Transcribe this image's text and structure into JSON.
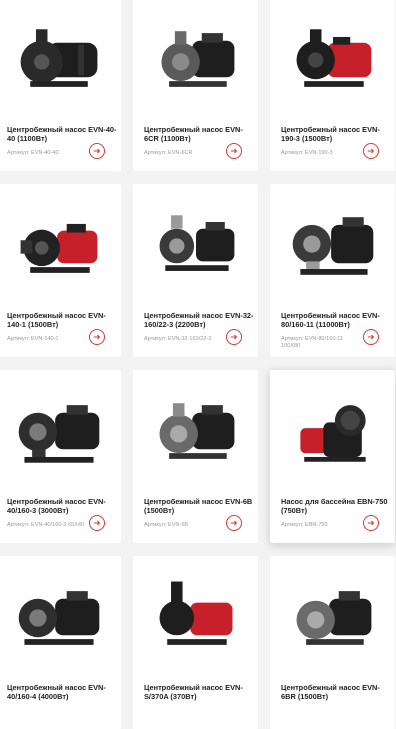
{
  "colors": {
    "accent": "#d33a3a",
    "pump_dark": "#1e1e1e",
    "pump_red": "#c8202a"
  },
  "products": [
    {
      "title": "Центробежный насос EVN-40-40 (1100Вт)",
      "sku": "Артикул: EVN-40-40",
      "icon": "pump-black-icon"
    },
    {
      "title": "Центробежный насос EVN-6CR (1100Вт)",
      "sku": "Артикул: EVN-6CR",
      "icon": "pump-black-icon"
    },
    {
      "title": "Центробежный насос EVN-190-3 (1500Вт)",
      "sku": "Артикул: EVN-190-3",
      "icon": "pump-red-icon"
    },
    {
      "title": "Центробежный насос EVN-140-1 (1500Вт)",
      "sku": "Артикул: EVN-140-1",
      "icon": "pump-red-icon"
    },
    {
      "title": "Центробежный насос EVN-32-160/22-3 (2200Вт)",
      "sku": "Артикул: EVN-32-160/22-3",
      "icon": "pump-black-icon"
    },
    {
      "title": "Центробежный насос EVN-80/160-11 (11000Вт)",
      "sku": "Артикул: EVN-80/160-11 100X80",
      "icon": "pump-black-icon"
    },
    {
      "title": "Центробежный насос EVN-40/160-3 (3000Вт)",
      "sku": "Артикул: EVN-40/160-3 65X40",
      "icon": "pump-black-icon"
    },
    {
      "title": "Центробежный насос EVN-6B (1500Вт)",
      "sku": "Артикул: EVN-6B",
      "icon": "pump-black-icon"
    },
    {
      "title": "Насос для бассейна EBN-750 (750Вт)",
      "sku": "Артикул: EBN-750",
      "icon": "pool-pump-icon"
    },
    {
      "title": "Центробежный насос EVN-40/160-4 (4000Вт)",
      "sku": "",
      "icon": "pump-black-icon"
    },
    {
      "title": "Центробежный насос EVN-S/370A (370Вт)",
      "sku": "",
      "icon": "pump-red-icon"
    },
    {
      "title": "Центробежный насос EVN-6BR (1500Вт)",
      "sku": "",
      "icon": "pump-black-icon"
    }
  ]
}
